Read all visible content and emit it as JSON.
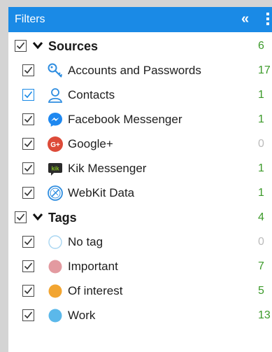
{
  "header": {
    "title": "Filters",
    "collapse_glyph": "«",
    "collapse_icon": "double-chevron-left-icon",
    "more_icon": "vertical-ellipsis-icon"
  },
  "sources": {
    "label": "Sources",
    "count": "6",
    "checked": true,
    "expanded": true,
    "items": [
      {
        "label": "Accounts and Passwords",
        "count": "17",
        "icon": "key-icon",
        "checked": true,
        "count_color": "green"
      },
      {
        "label": "Contacts",
        "count": "1",
        "icon": "person-icon",
        "checked": true,
        "count_color": "green"
      },
      {
        "label": "Facebook Messenger",
        "count": "1",
        "icon": "messenger-icon",
        "checked": true,
        "count_color": "green"
      },
      {
        "label": "Google+",
        "count": "0",
        "icon": "google-plus-icon",
        "checked": true,
        "count_color": "gray"
      },
      {
        "label": "Kik Messenger",
        "count": "1",
        "icon": "kik-icon",
        "checked": true,
        "count_color": "green"
      },
      {
        "label": "WebKit Data",
        "count": "1",
        "icon": "webkit-icon",
        "checked": true,
        "count_color": "green"
      }
    ]
  },
  "tags": {
    "label": "Tags",
    "count": "4",
    "checked": true,
    "expanded": true,
    "items": [
      {
        "label": "No tag",
        "count": "0",
        "color": "#ffffff",
        "icon": "empty-circle-icon",
        "checked": true,
        "count_color": "gray"
      },
      {
        "label": "Important",
        "count": "7",
        "color": "#e39aa0",
        "icon": "pink-dot-icon",
        "checked": true,
        "count_color": "green"
      },
      {
        "label": "Of interest",
        "count": "5",
        "color": "#f2a531",
        "icon": "orange-dot-icon",
        "checked": true,
        "count_color": "green"
      },
      {
        "label": "Work",
        "count": "13",
        "color": "#5bb8ea",
        "icon": "blue-dot-icon",
        "checked": true,
        "count_color": "green"
      }
    ]
  },
  "colors": {
    "header_bg": "#1a8ae6",
    "count_green": "#3c9a2a",
    "count_gray": "#bbbbbb"
  }
}
